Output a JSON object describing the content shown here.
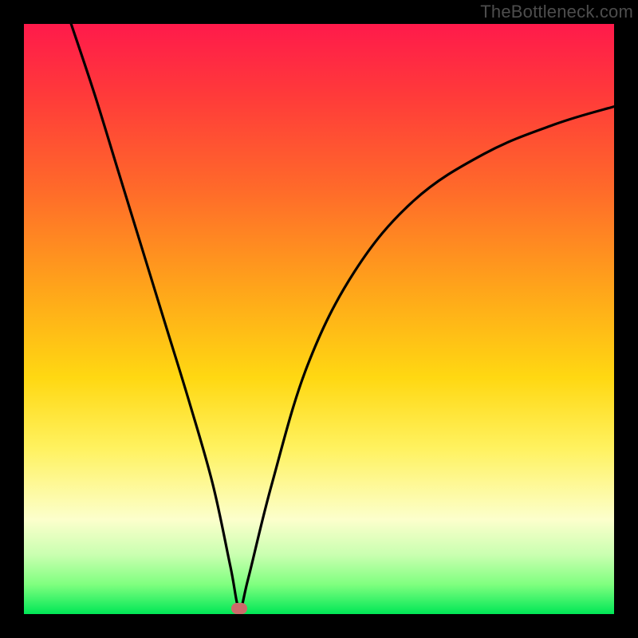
{
  "watermark": "TheBottleneck.com",
  "chart_data": {
    "type": "line",
    "title": "",
    "xlabel": "",
    "ylabel": "",
    "xlim": [
      0,
      100
    ],
    "ylim": [
      0,
      100
    ],
    "grid": false,
    "legend": false,
    "series": [
      {
        "name": "bottleneck-curve",
        "x": [
          8,
          12,
          16,
          20,
          24,
          28,
          32,
          35,
          36.5,
          38,
          42,
          48,
          56,
          66,
          78,
          90,
          100
        ],
        "y": [
          100,
          88,
          75,
          62,
          49,
          36,
          22,
          8,
          1,
          6,
          22,
          42,
          58,
          70,
          78,
          83,
          86
        ]
      }
    ],
    "marker": {
      "x": 36.5,
      "y": 1
    },
    "gradient_stops": [
      {
        "pct": 0,
        "color": "#ff1a4b"
      },
      {
        "pct": 12,
        "color": "#ff3a3a"
      },
      {
        "pct": 28,
        "color": "#ff6a2a"
      },
      {
        "pct": 45,
        "color": "#ffa51a"
      },
      {
        "pct": 60,
        "color": "#ffd812"
      },
      {
        "pct": 72,
        "color": "#fff260"
      },
      {
        "pct": 84,
        "color": "#fcffcc"
      },
      {
        "pct": 90,
        "color": "#c9ffb0"
      },
      {
        "pct": 95,
        "color": "#7fff7f"
      },
      {
        "pct": 100,
        "color": "#00e756"
      }
    ]
  }
}
